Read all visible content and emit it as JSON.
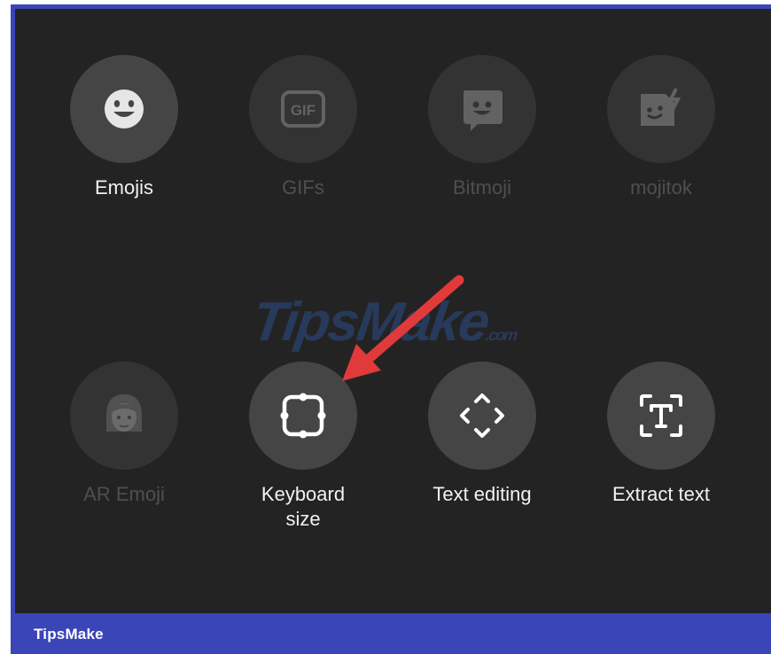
{
  "panel": {
    "row1": [
      {
        "key": "emojis",
        "label": "Emojis",
        "icon": "smiley-face-icon",
        "enabled": true
      },
      {
        "key": "gifs",
        "label": "GIFs",
        "icon": "gif-icon",
        "enabled": false
      },
      {
        "key": "bitmoji",
        "label": "Bitmoji",
        "icon": "bitmoji-icon",
        "enabled": false
      },
      {
        "key": "mojitok",
        "label": "mojitok",
        "icon": "mojitok-sticker-icon",
        "enabled": false
      }
    ],
    "row2": [
      {
        "key": "ar_emoji",
        "label": "AR Emoji",
        "icon": "ar-emoji-avatar-icon",
        "enabled": false
      },
      {
        "key": "keyboard_size",
        "label": "Keyboard\nsize",
        "icon": "resize-frame-icon",
        "enabled": true
      },
      {
        "key": "text_editing",
        "label": "Text editing",
        "icon": "cursor-arrows-icon",
        "enabled": true
      },
      {
        "key": "extract_text",
        "label": "Extract text",
        "icon": "text-scan-icon",
        "enabled": true
      }
    ]
  },
  "watermark": {
    "text": "TipsMake",
    "suffix": ".com"
  },
  "footer": {
    "brand": "TipsMake"
  },
  "colors": {
    "panel_bg": "#232323",
    "circle_bg": "#454545",
    "frame_blue": "#3a45b8",
    "arrow_red": "#e03a3a"
  }
}
